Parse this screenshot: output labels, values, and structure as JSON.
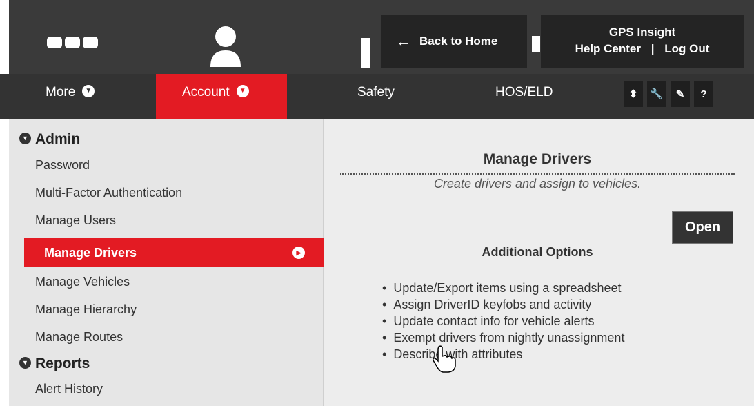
{
  "header": {
    "back_home": "Back to Home",
    "gps_title": "GPS Insight",
    "help_center": "Help Center",
    "separator": "|",
    "log_out": "Log Out"
  },
  "nav": {
    "more": "More",
    "account": "Account",
    "safety": "Safety",
    "hos": "HOS/ELD"
  },
  "tools": [
    "⬍",
    "🔧",
    "✎",
    "?"
  ],
  "menu": {
    "admin": "Admin",
    "admin_items": [
      "Password",
      "Multi-Factor Authentication",
      "Manage Users",
      "Manage Drivers",
      "Manage Vehicles",
      "Manage Hierarchy",
      "Manage Routes"
    ],
    "reports": "Reports",
    "reports_items": [
      "Alert History"
    ]
  },
  "panel": {
    "title": "Manage Drivers",
    "subtitle": "Create drivers and assign to vehicles.",
    "open": "Open",
    "additional": "Additional Options",
    "options": [
      "Update/Export items using a spreadsheet",
      "Assign DriverID keyfobs and activity",
      "Update contact info for vehicle alerts",
      "Exempt drivers from nightly unassignment",
      "Describe with attributes"
    ]
  },
  "colors": {
    "accent": "#e31b23",
    "dark": "#333333"
  }
}
